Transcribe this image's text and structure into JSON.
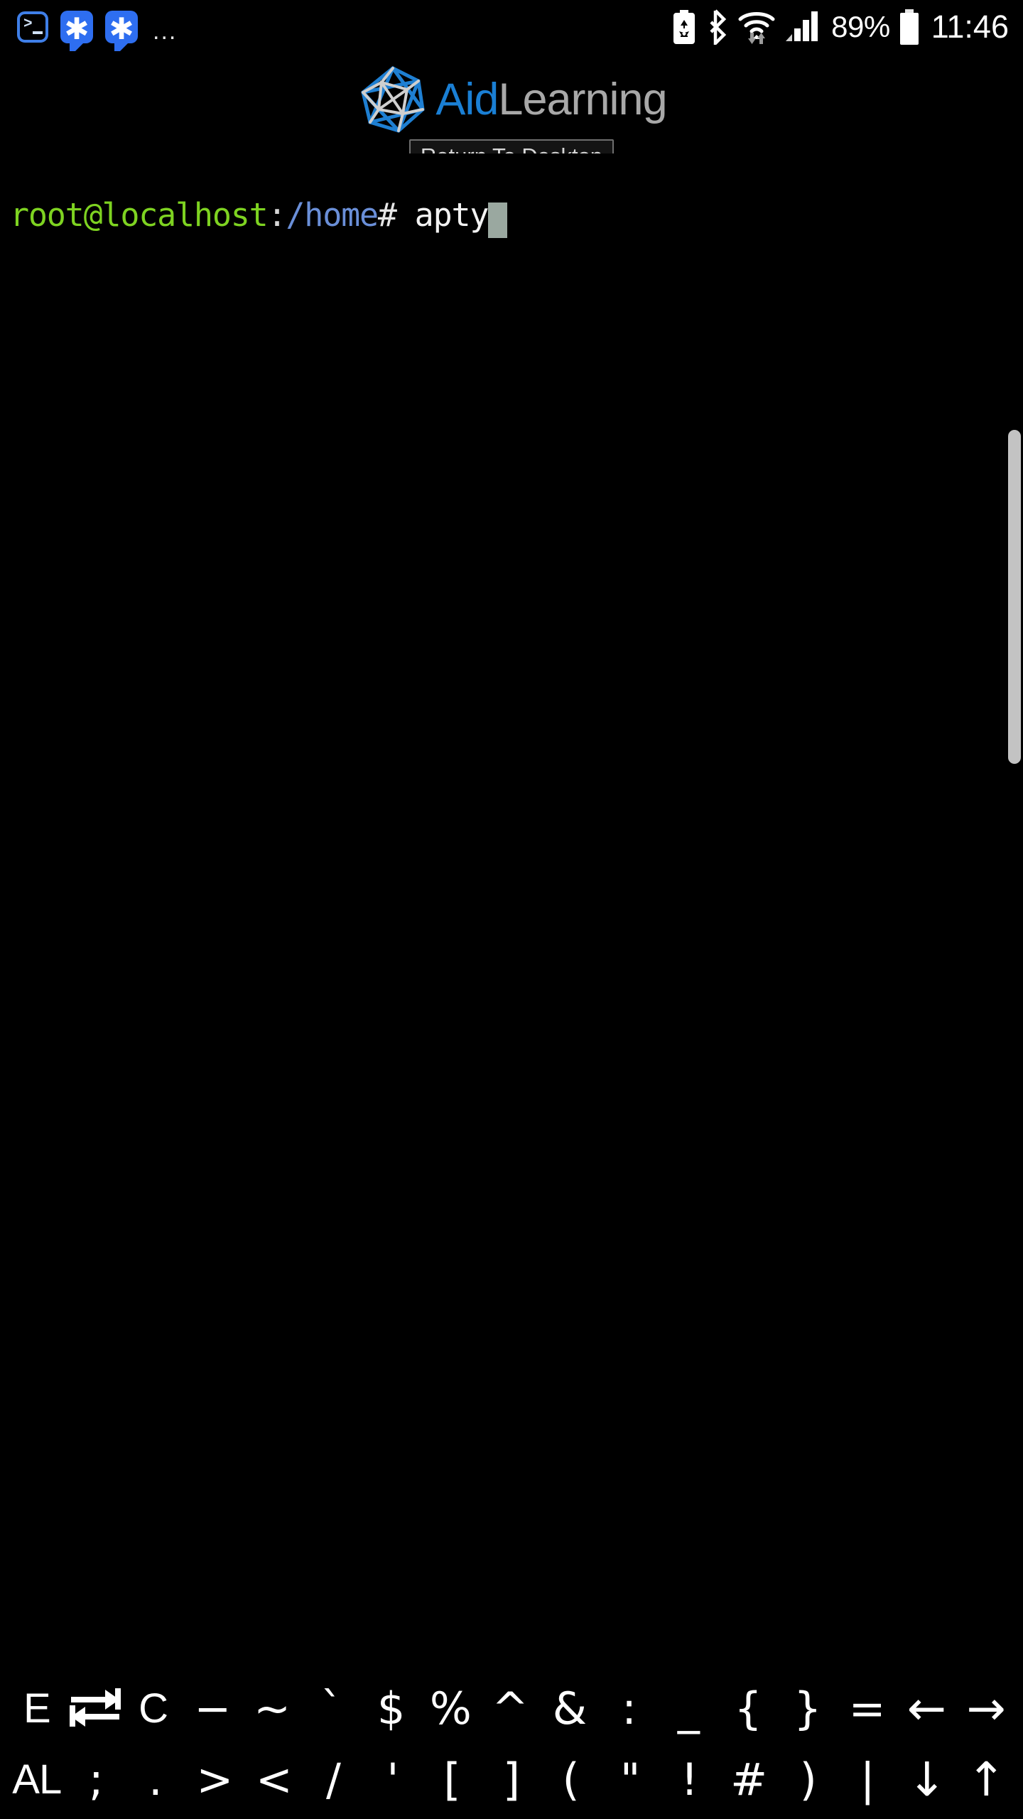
{
  "status_bar": {
    "notifications": [
      {
        "name": "terminal-notification-icon",
        "icon": "terminal-icon"
      },
      {
        "name": "asterisk-notification-icon-1",
        "icon": "asterisk-bubble-icon",
        "glyph": "✱"
      },
      {
        "name": "asterisk-notification-icon-2",
        "icon": "asterisk-bubble-icon",
        "glyph": "✱"
      }
    ],
    "overflow": "...",
    "icons": [
      {
        "name": "battery-saver-icon"
      },
      {
        "name": "bluetooth-icon"
      },
      {
        "name": "wifi-transfer-icon"
      },
      {
        "name": "cellular-signal-icon"
      }
    ],
    "battery_percent": "89%",
    "battery_icon": "battery-full-icon",
    "clock": "11:46"
  },
  "header": {
    "logo_mark": "polyhedron-wireframe-icon",
    "brand_primary": "Aid",
    "brand_secondary": "Learning",
    "brand_primary_color": "#1a7fd4",
    "brand_secondary_color": "#a8a8a8",
    "return_button_label": "Return To Desktop"
  },
  "terminal": {
    "prompt_user": "root@localhost",
    "prompt_colon": ":",
    "prompt_path": "/home",
    "prompt_hash": "#",
    "command": " apty",
    "cursor": "block-cursor",
    "colors": {
      "background": "#000000",
      "user": "#7ed321",
      "path": "#6a8fd8",
      "command": "#f2f2f2",
      "cursor": "#9aa8a0"
    },
    "scrollbar": "vertical-scrollbar"
  },
  "key_bar": {
    "row1": [
      {
        "label": "E",
        "name": "key-esc",
        "type": "word"
      },
      {
        "label": "",
        "name": "key-tab",
        "type": "tab-icon"
      },
      {
        "label": "C",
        "name": "key-ctrl",
        "type": "word"
      },
      {
        "label": "−",
        "name": "key-minus",
        "type": "sym"
      },
      {
        "label": "~",
        "name": "key-tilde",
        "type": "sym"
      },
      {
        "label": "`",
        "name": "key-backtick",
        "type": "sym"
      },
      {
        "label": "$",
        "name": "key-dollar",
        "type": "sym"
      },
      {
        "label": "%",
        "name": "key-percent",
        "type": "sym"
      },
      {
        "label": "^",
        "name": "key-caret",
        "type": "sym"
      },
      {
        "label": "&",
        "name": "key-ampersand",
        "type": "sym"
      },
      {
        "label": ":",
        "name": "key-colon",
        "type": "sym"
      },
      {
        "label": "_",
        "name": "key-underscore",
        "type": "sym"
      },
      {
        "label": "{",
        "name": "key-brace-open",
        "type": "sym"
      },
      {
        "label": "}",
        "name": "key-brace-close",
        "type": "sym"
      },
      {
        "label": "=",
        "name": "key-equals",
        "type": "sym"
      },
      {
        "label": "←",
        "name": "key-arrow-left",
        "type": "arrow"
      },
      {
        "label": "→",
        "name": "key-arrow-right",
        "type": "arrow"
      }
    ],
    "row2": [
      {
        "label": "AL",
        "name": "key-alt",
        "type": "word"
      },
      {
        "label": ";",
        "name": "key-semicolon",
        "type": "sym"
      },
      {
        "label": ".",
        "name": "key-period",
        "type": "sym"
      },
      {
        "label": ">",
        "name": "key-greater-than",
        "type": "sym"
      },
      {
        "label": "<",
        "name": "key-less-than",
        "type": "sym"
      },
      {
        "label": "/",
        "name": "key-slash",
        "type": "sym"
      },
      {
        "label": "'",
        "name": "key-apostrophe",
        "type": "sym"
      },
      {
        "label": "[",
        "name": "key-bracket-open",
        "type": "sym"
      },
      {
        "label": "]",
        "name": "key-bracket-close",
        "type": "sym"
      },
      {
        "label": "(",
        "name": "key-paren-open",
        "type": "sym"
      },
      {
        "label": "\"",
        "name": "key-quote",
        "type": "sym"
      },
      {
        "label": "!",
        "name": "key-exclamation",
        "type": "sym"
      },
      {
        "label": "#",
        "name": "key-hash",
        "type": "sym"
      },
      {
        "label": ")",
        "name": "key-paren-close",
        "type": "sym"
      },
      {
        "label": "|",
        "name": "key-pipe",
        "type": "sym"
      },
      {
        "label": "↓",
        "name": "key-arrow-down",
        "type": "arrow"
      },
      {
        "label": "↑",
        "name": "key-arrow-up",
        "type": "arrow"
      }
    ]
  }
}
